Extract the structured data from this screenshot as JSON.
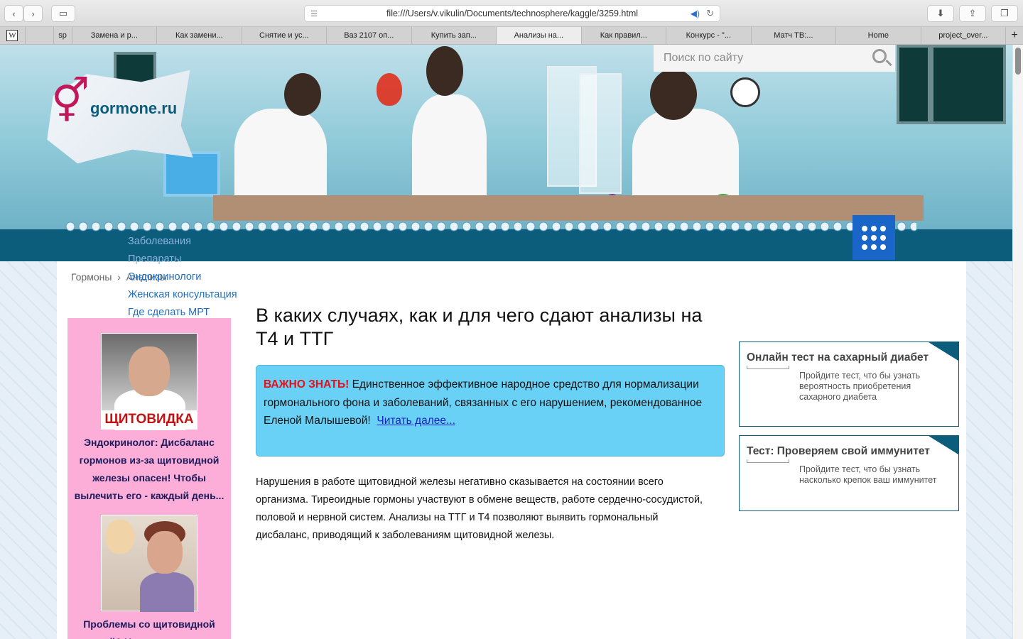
{
  "browser": {
    "url": "file:///Users/v.vikulin/Documents/technosphere/kaggle/3259.html",
    "tabs": [
      {
        "label": "sp"
      },
      {
        "label": "Замена и р..."
      },
      {
        "label": "Как замени..."
      },
      {
        "label": "Снятие и ус..."
      },
      {
        "label": "Ваз 2107 оп..."
      },
      {
        "label": "Купить зап..."
      },
      {
        "label": "Анализы на...",
        "active": true
      },
      {
        "label": "Как правил..."
      },
      {
        "label": "Конкурс - \"..."
      },
      {
        "label": "Матч ТВ:..."
      },
      {
        "label": "Home"
      },
      {
        "label": "project_over..."
      }
    ]
  },
  "site": {
    "logo_text": "gormone.ru",
    "search_placeholder": "Поиск по сайту",
    "accent_color": "#0c5d7c"
  },
  "menu": {
    "items": [
      "Заболевания",
      "Препараты",
      "Эндокринологи",
      "Женская консультация",
      "Где сделать МРТ"
    ]
  },
  "breadcrumbs": {
    "home": "Гормоны",
    "separator": "›",
    "current": "Анализы"
  },
  "sidebar": {
    "ad1": {
      "caption": "ЩИТОВИДКА",
      "text": "Эндокринолог: Дисбаланс гормонов из-за щитовидной железы опасен! Чтобы вылечить его - каждый день..."
    },
    "ad2": {
      "text": "Проблемы со щитовидной железой? Нужно всего лишь..."
    }
  },
  "article": {
    "title": "В каких случаях, как и для чего сдают анализы на Т4 и ТТГ",
    "notice": {
      "label": "ВАЖНО ЗНАТЬ!",
      "text": "Единственное эффективное народное средство для нормализации гормонального фона и заболеваний, связанных с его нарушением, рекомендованное Еленой Малышевой!",
      "link": "Читать далее..."
    },
    "body": "Нарушения в работе щитовидной железы негативно сказывается на состоянии всего организма. Тиреоидные гормоны участвуют в обмене веществ, работе сердечно-сосудистой, половой и нервной систем. Анализы на ТТГ и Т4 позволяют выявить гормональный дисбаланс, приводящий к заболеваниям щитовидной железы."
  },
  "widgets": [
    {
      "title": "Онлайн тест на сахарный диабет",
      "desc": "Пройдите тест, что бы узнать вероятность приобретения сахарного диабета"
    },
    {
      "title": "Тест: Проверяем свой иммунитет",
      "desc": "Пройдите тест, что бы узнать насколько крепок ваш иммунитет"
    }
  ],
  "icons": [
    "back-icon",
    "forward-icon",
    "sidebar-icon",
    "reader-icon",
    "audio-icon",
    "reload-icon",
    "download-icon",
    "share-icon",
    "tabs-icon",
    "search-icon",
    "grid-menu-icon"
  ]
}
